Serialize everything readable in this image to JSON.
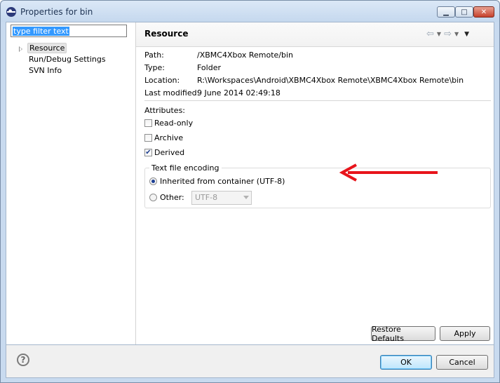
{
  "window": {
    "title": "Properties for bin"
  },
  "filter": {
    "text": "type filter text"
  },
  "tree": {
    "items": [
      {
        "label": "Resource"
      },
      {
        "label": "Run/Debug Settings"
      },
      {
        "label": "SVN Info"
      }
    ]
  },
  "page": {
    "title": "Resource"
  },
  "props": {
    "path_label": "Path:",
    "path_value": "/XBMC4Xbox Remote/bin",
    "type_label": "Type:",
    "type_value": "Folder",
    "location_label": "Location:",
    "location_value": "R:\\Workspaces\\Android\\XBMC4Xbox Remote\\XBMC4Xbox Remote\\bin",
    "modified_label": "Last modified:",
    "modified_value": "9 June 2014 02:49:18"
  },
  "attributes": {
    "title": "Attributes:",
    "readonly": {
      "label": "Read-only",
      "checked": false
    },
    "archive": {
      "label": "Archive",
      "checked": false
    },
    "derived": {
      "label": "Derived",
      "checked": true
    }
  },
  "encoding": {
    "title": "Text file encoding",
    "inherited_label": "Inherited from container (UTF-8)",
    "other_label": "Other:",
    "other_value": "UTF-8"
  },
  "buttons": {
    "restore": "Restore Defaults",
    "apply": "Apply",
    "ok": "OK",
    "cancel": "Cancel"
  },
  "annotation": {
    "color": "#e8141b"
  }
}
